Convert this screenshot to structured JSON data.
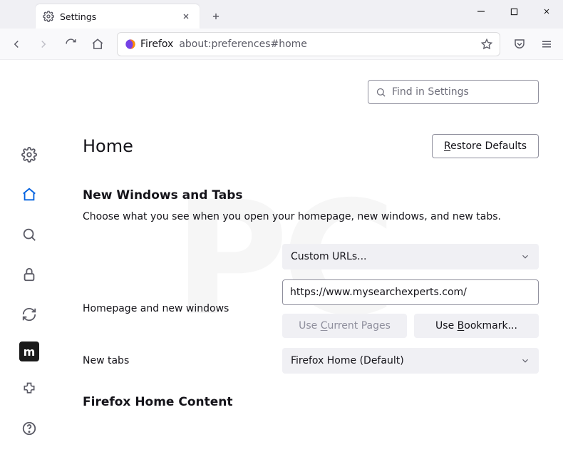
{
  "tab": {
    "title": "Settings"
  },
  "urlbar": {
    "prefix": "Firefox",
    "url": "about:preferences#home"
  },
  "search": {
    "placeholder": "Find in Settings"
  },
  "header": {
    "title": "Home",
    "restore_label": "Restore Defaults"
  },
  "section1": {
    "title": "New Windows and Tabs",
    "desc": "Choose what you see when you open your homepage, new windows, and new tabs."
  },
  "homepage": {
    "label": "Homepage and new windows",
    "mode": "Custom URLs...",
    "url": "https://www.mysearchexperts.com/",
    "use_current": "Use Current Pages",
    "use_bookmark": "Use Bookmark..."
  },
  "newtabs": {
    "label": "New tabs",
    "mode": "Firefox Home (Default)"
  },
  "section2": {
    "title": "Firefox Home Content"
  }
}
